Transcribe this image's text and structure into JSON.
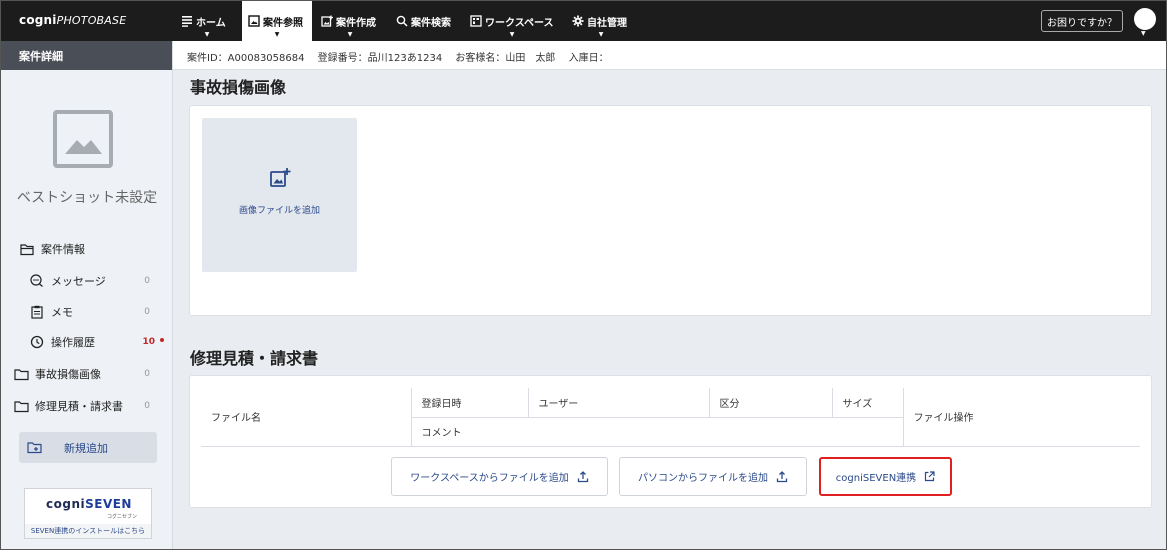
{
  "app": {
    "logo_main": "cogni",
    "logo_sub": "PHOTOBASE"
  },
  "nav": {
    "home": "ホーム",
    "case_view": "案件参照",
    "case_create": "案件作成",
    "case_search": "案件検索",
    "workspace": "ワークスペース",
    "company": "自社管理",
    "help": "お困りですか？"
  },
  "sidebar": {
    "header": "案件詳細",
    "bestshot_text": "ベストショット未設定",
    "case_info": "案件情報",
    "message": "メッセージ",
    "message_count": "0",
    "memo": "メモ",
    "memo_count": "0",
    "history": "操作履歴",
    "history_count": "10",
    "accident_images": "事故損傷画像",
    "accident_count": "0",
    "repair_docs": "修理見積・請求書",
    "repair_count": "0",
    "add_new": "新規追加",
    "seven_logo_a": "cogni",
    "seven_logo_b": "SEVEN",
    "seven_sub": "コグニセブン",
    "seven_link": "SEVEN連携のインストールはこちら"
  },
  "infobar": {
    "case_id": "案件ID：A00083058684",
    "reg_no": "登録番号：品川123あ1234",
    "customer": "お客様名：山田　太郎",
    "entry_date": "入庫日："
  },
  "accident": {
    "title": "事故損傷画像",
    "add_image": "画像ファイルを追加"
  },
  "repair": {
    "title": "修理見積・請求書",
    "col_filename": "ファイル名",
    "col_date": "登録日時",
    "col_user": "ユーザー",
    "col_type": "区分",
    "col_size": "サイズ",
    "col_ops": "ファイル操作",
    "col_comment": "コメント",
    "btn_workspace": "ワークスペースからファイルを追加",
    "btn_pc": "パソコンからファイルを追加",
    "btn_seven": "cogniSEVEN連携"
  }
}
